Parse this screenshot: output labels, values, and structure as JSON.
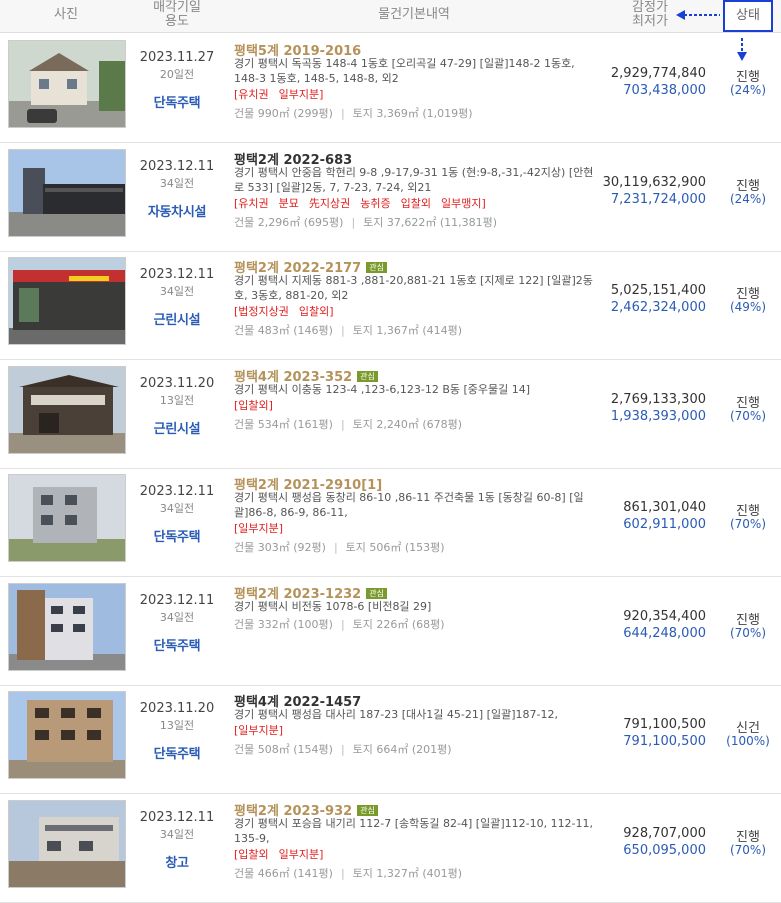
{
  "header": {
    "photo": "사진",
    "date_use_1": "매각기일",
    "date_use_2": "용도",
    "info": "물건기본내역",
    "price_1": "감정가",
    "price_2": "최저가",
    "status": "상태"
  },
  "colors": {
    "accent": "#1a3fd6",
    "case_gold": "#b5925a",
    "link_blue": "#2a5bb5",
    "tag_red": "#e02020",
    "badge_green": "#7a9a2c"
  },
  "rows": [
    {
      "date": "2023.11.27",
      "ago": "20일전",
      "use": "단독주택",
      "case": "평택5계 2019-2016",
      "interest": "",
      "addr": "경기 평택시 독곡동 148-4 1동호 [오리곡길 47-29] [일괄]148-2 1동호, 148-3 1동호, 148-5, 148-8, 외2",
      "tags": [
        "[유치권",
        "일부지분]"
      ],
      "building": "건물 990㎡ (299평)",
      "land": "토지 3,369㎡ (1,019평)",
      "appraisal": "2,929,774,840",
      "minimum": "703,438,000",
      "status": "진행",
      "percent": "(24%)"
    },
    {
      "date": "2023.12.11",
      "ago": "34일전",
      "use": "자동차시설",
      "case": "평택2계 2022-683",
      "interest": "",
      "addr": "경기 평택시 안중읍 학현리 9-8 ,9-17,9-31 1동 (현:9-8,-31,-42지상) [안현로 533] [일괄]2동, 7, 7-23, 7-24, 외21",
      "tags": [
        "[유치권",
        "분묘",
        "先지상권",
        "농취증",
        "입찰외",
        "일부맹지]"
      ],
      "building": "건물 2,296㎡ (695평)",
      "land": "토지 37,622㎡ (11,381평)",
      "appraisal": "30,119,632,900",
      "minimum": "7,231,724,000",
      "status": "진행",
      "percent": "(24%)"
    },
    {
      "date": "2023.12.11",
      "ago": "34일전",
      "use": "근린시설",
      "case": "평택2계 2022-2177",
      "interest": "관심",
      "addr": "경기 평택시 지제동 881-3 ,881-20,881-21 1동호 [지제로 122] [일괄]2동호, 3동호, 881-20, 외2",
      "tags": [
        "[법정지상권",
        "입찰외]"
      ],
      "building": "건물 483㎡ (146평)",
      "land": "토지 1,367㎡ (414평)",
      "appraisal": "5,025,151,400",
      "minimum": "2,462,324,000",
      "status": "진행",
      "percent": "(49%)"
    },
    {
      "date": "2023.11.20",
      "ago": "13일전",
      "use": "근린시설",
      "case": "평택4계 2023-352",
      "interest": "관심",
      "addr": "경기 평택시 이충동 123-4 ,123-6,123-12 B동 [중우물길 14]",
      "tags": [
        "[입찰외]"
      ],
      "building": "건물 534㎡ (161평)",
      "land": "토지 2,240㎡ (678평)",
      "appraisal": "2,769,133,300",
      "minimum": "1,938,393,000",
      "status": "진행",
      "percent": "(70%)"
    },
    {
      "date": "2023.12.11",
      "ago": "34일전",
      "use": "단독주택",
      "case": "평택2계 2021-2910[1]",
      "interest": "",
      "addr": "경기 평택시 팽성읍 동창리 86-10 ,86-11 주건축물 1동 [동창길 60-8] [일괄]86-8, 86-9, 86-11,",
      "tags": [
        "[일부지분]"
      ],
      "building": "건물 303㎡ (92평)",
      "land": "토지 506㎡ (153평)",
      "appraisal": "861,301,040",
      "minimum": "602,911,000",
      "status": "진행",
      "percent": "(70%)"
    },
    {
      "date": "2023.12.11",
      "ago": "34일전",
      "use": "단독주택",
      "case": "평택2계 2023-1232",
      "interest": "관심",
      "addr": "경기 평택시 비전동 1078-6 [비전8길 29]",
      "tags": [],
      "building": "건물 332㎡ (100평)",
      "land": "토지 226㎡ (68평)",
      "appraisal": "920,354,400",
      "minimum": "644,248,000",
      "status": "진행",
      "percent": "(70%)"
    },
    {
      "date": "2023.11.20",
      "ago": "13일전",
      "use": "단독주택",
      "case": "평택4계 2022-1457",
      "interest": "",
      "addr": "경기 평택시 팽성읍 대사리 187-23 [대사1길 45-21] [일괄]187-12,",
      "tags": [
        "[일부지분]"
      ],
      "building": "건물 508㎡ (154평)",
      "land": "토지 664㎡ (201평)",
      "appraisal": "791,100,500",
      "minimum": "791,100,500",
      "status": "신건",
      "percent": "(100%)"
    },
    {
      "date": "2023.12.11",
      "ago": "34일전",
      "use": "창고",
      "case": "평택2계 2023-932",
      "interest": "관심",
      "addr": "경기 평택시 포승읍 내기리 112-7 [송학동길 82-4] [일괄]112-10, 112-11, 135-9,",
      "tags": [
        "[입찰외",
        "일부지분]"
      ],
      "building": "건물 466㎡ (141평)",
      "land": "토지 1,327㎡ (401평)",
      "appraisal": "928,707,000",
      "minimum": "650,095,000",
      "status": "진행",
      "percent": "(70%)"
    }
  ]
}
